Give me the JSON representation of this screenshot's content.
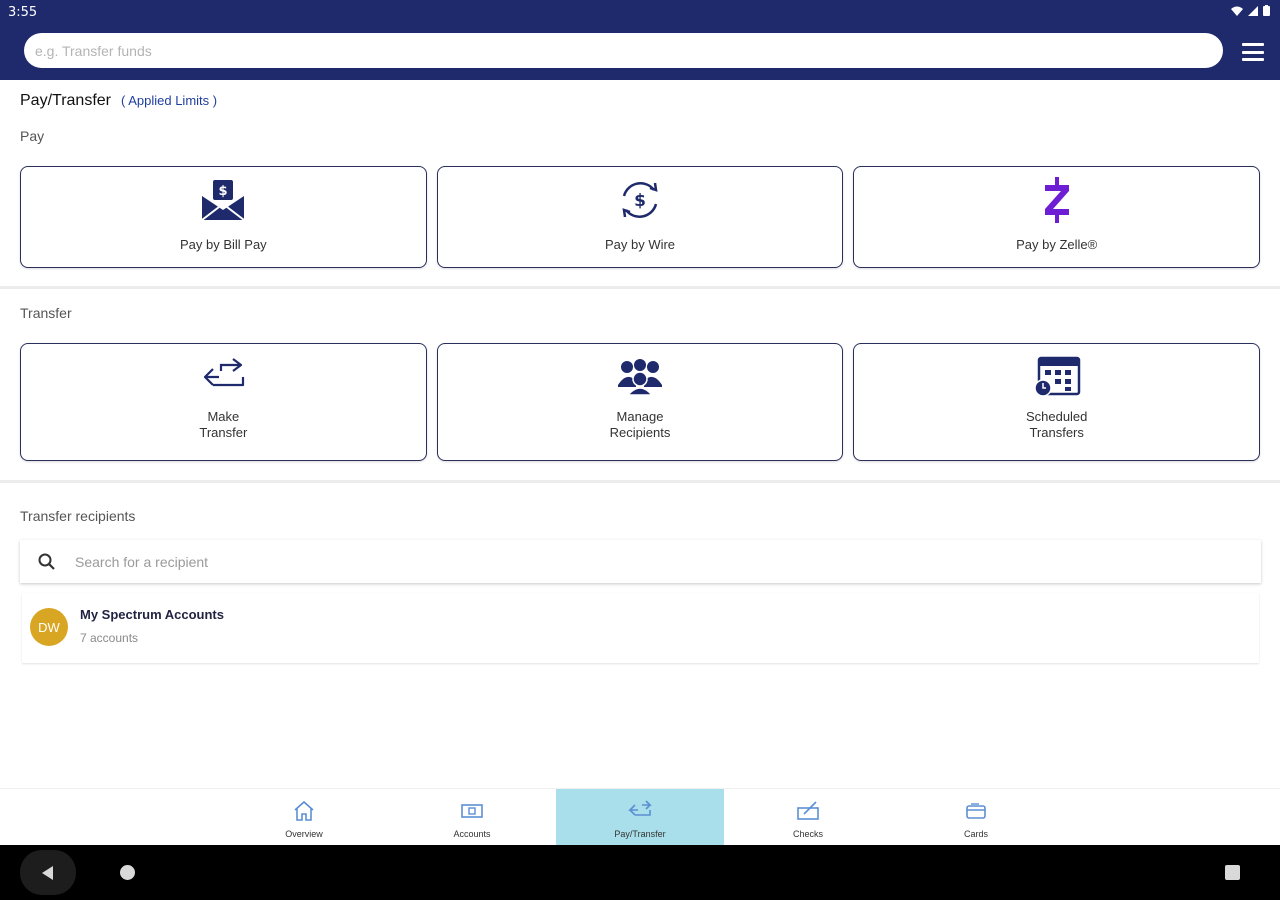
{
  "status_bar": {
    "time": "3:55"
  },
  "search": {
    "placeholder": "e.g. Transfer funds"
  },
  "header": {
    "title": "Pay/Transfer",
    "limits_link": "( Applied Limits )"
  },
  "sections": {
    "pay": "Pay",
    "transfer": "Transfer",
    "recipients": "Transfer recipients"
  },
  "pay_tiles": [
    {
      "label": "Pay by Bill Pay",
      "icon": "bill-pay-envelope-icon"
    },
    {
      "label": "Pay by Wire",
      "icon": "wire-dollar-cycle-icon"
    },
    {
      "label": "Pay by Zelle®",
      "icon": "zelle-icon"
    }
  ],
  "transfer_tiles": [
    {
      "label": "Make\nTransfer",
      "icon": "transfer-arrows-icon"
    },
    {
      "label": "Manage\nRecipients",
      "icon": "recipients-group-icon"
    },
    {
      "label": "Scheduled\nTransfers",
      "icon": "calendar-clock-icon"
    }
  ],
  "recipient_search": {
    "placeholder": "Search for a recipient"
  },
  "recipients": [
    {
      "initials": "DW",
      "name": "My Spectrum Accounts",
      "subtitle": "7 accounts"
    }
  ],
  "tabs": [
    {
      "label": "Overview",
      "icon": "home-icon",
      "active": false
    },
    {
      "label": "Accounts",
      "icon": "accounts-icon",
      "active": false
    },
    {
      "label": "Pay/Transfer",
      "icon": "pay-transfer-icon",
      "active": true
    },
    {
      "label": "Checks",
      "icon": "checks-icon",
      "active": false
    },
    {
      "label": "Cards",
      "icon": "cards-icon",
      "active": false
    }
  ],
  "colors": {
    "header": "#1e2a6b",
    "tile_border": "#2a2f5c",
    "zelle": "#6d1ed4",
    "active_tab": "#a9dfea",
    "avatar": "#d9a623",
    "link": "#1f3fa0"
  }
}
